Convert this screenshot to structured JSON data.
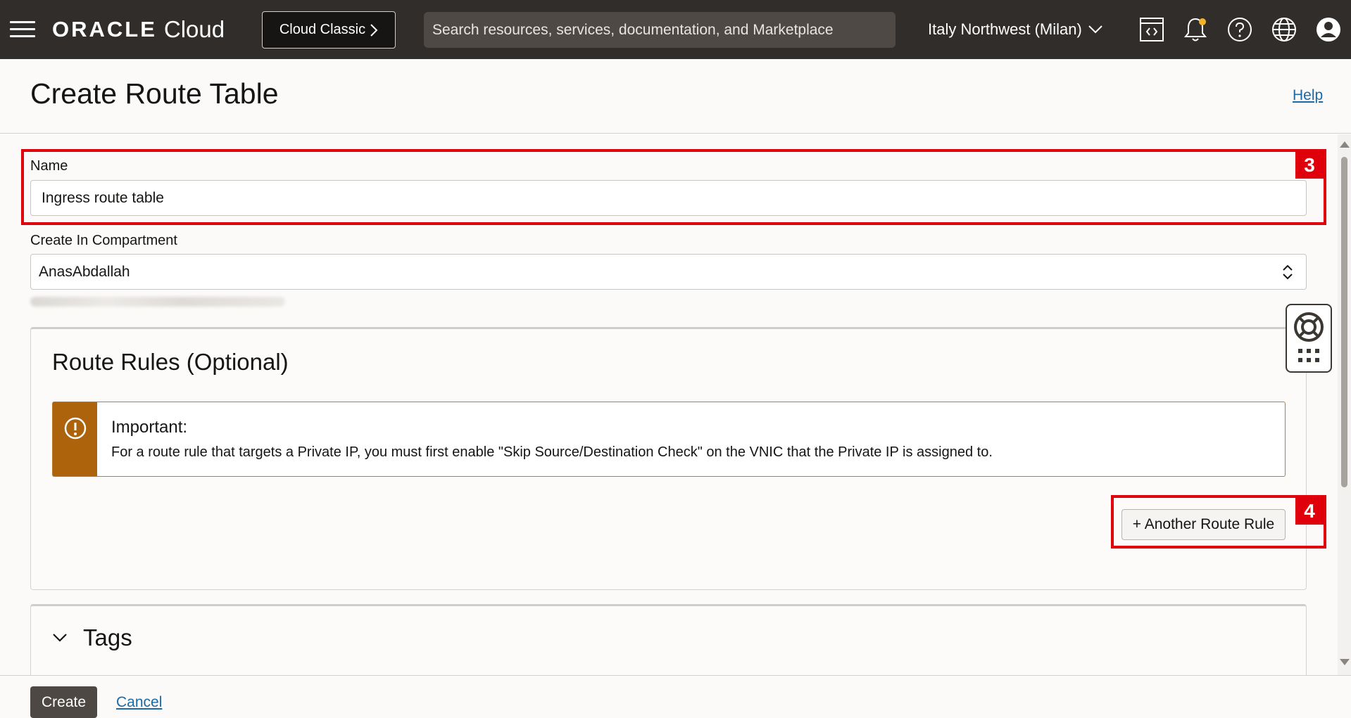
{
  "topbar": {
    "brand": "ORACLE",
    "product": "Cloud",
    "classic_label": "Cloud Classic",
    "search_placeholder": "Search resources, services, documentation, and Marketplace",
    "region": "Italy Northwest (Milan)",
    "icons": [
      "menu-icon",
      "code-editor-icon",
      "bell-icon",
      "help-icon",
      "globe-icon",
      "user-icon"
    ]
  },
  "header": {
    "title": "Create Route Table",
    "help": "Help"
  },
  "form": {
    "name_label": "Name",
    "name_value": "Ingress route table",
    "compartment_label": "Create In Compartment",
    "compartment_value": "AnasAbdallah"
  },
  "route_rules": {
    "title": "Route Rules (Optional)",
    "alert_title": "Important:",
    "alert_text": "For a route rule that targets a Private IP, you must first enable \"Skip Source/Destination Check\" on the VNIC that the Private IP is assigned to.",
    "add_button": "+ Another Route Rule"
  },
  "tags": {
    "title": "Tags"
  },
  "annotations": [
    {
      "label": "3",
      "color": "#e0000b"
    },
    {
      "label": "4",
      "color": "#e0000b"
    }
  ],
  "footer": {
    "create": "Create",
    "cancel": "Cancel"
  },
  "colors": {
    "topbar": "#312d2a",
    "alert_accent": "#ac630c",
    "link": "#1a6aa8",
    "primary_button": "#4d4843",
    "annotation": "#e0000b"
  }
}
